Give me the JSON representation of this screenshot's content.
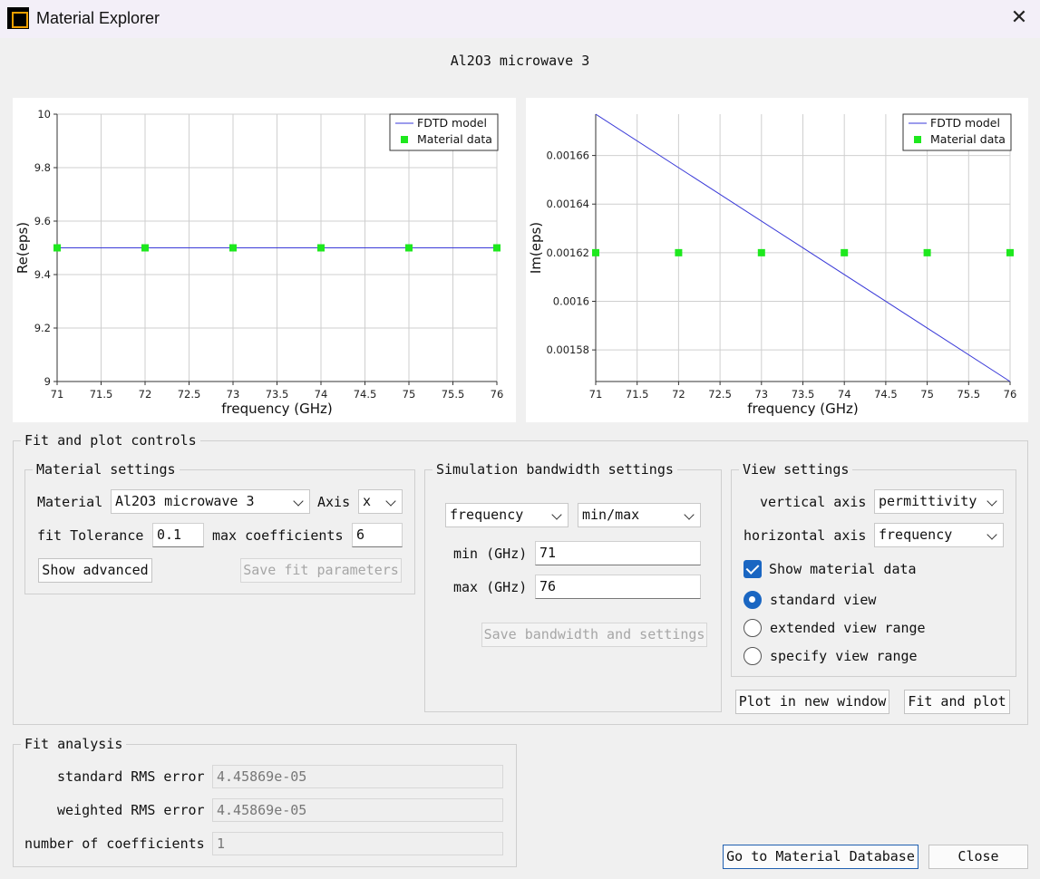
{
  "window": {
    "title": "Material Explorer",
    "close_glyph": "✕",
    "app_icon": "app-logo-icon"
  },
  "heading": "Al2O3 microwave 3",
  "chart_data": [
    {
      "type": "line",
      "xlabel": "frequency (GHz)",
      "ylabel": "Re(eps)",
      "xlim": [
        71,
        76
      ],
      "ylim": [
        9,
        10
      ],
      "xticks": [
        71,
        71.5,
        72,
        72.5,
        73,
        73.5,
        74,
        74.5,
        75,
        75.5,
        76
      ],
      "xtick_labels": [
        "71",
        "71.5",
        "72",
        "72.5",
        "73",
        "73.5",
        "74",
        "74.5",
        "75",
        "75.5",
        "76"
      ],
      "yticks": [
        9,
        9.2,
        9.4,
        9.6,
        9.8,
        10
      ],
      "ytick_labels": [
        "9",
        "9.2",
        "9.4",
        "9.6",
        "9.8",
        "10"
      ],
      "grid": true,
      "legend_position": "top-right",
      "series": [
        {
          "name": "FDTD model",
          "kind": "line",
          "color": "#3a3ad8",
          "x": [
            71,
            76
          ],
          "y": [
            9.5,
            9.5
          ]
        },
        {
          "name": "Material data",
          "kind": "marker",
          "color": "#1ee81e",
          "x": [
            71,
            72,
            73,
            74,
            75,
            76
          ],
          "y": [
            9.5,
            9.5,
            9.5,
            9.5,
            9.5,
            9.5
          ]
        }
      ]
    },
    {
      "type": "line",
      "xlabel": "frequency (GHz)",
      "ylabel": "Im(eps)",
      "xlim": [
        71,
        76
      ],
      "ylim": [
        0.001567,
        0.001677
      ],
      "xticks": [
        71,
        71.5,
        72,
        72.5,
        73,
        73.5,
        74,
        74.5,
        75,
        75.5,
        76
      ],
      "xtick_labels": [
        "71",
        "71.5",
        "72",
        "72.5",
        "73",
        "73.5",
        "74",
        "74.5",
        "75",
        "75.5",
        "76"
      ],
      "yticks": [
        0.00158,
        0.0016,
        0.00162,
        0.00164,
        0.00166
      ],
      "ytick_labels": [
        "0.00158",
        "0.0016",
        "0.00162",
        "0.00164",
        "0.00166"
      ],
      "grid": true,
      "legend_position": "top-right",
      "series": [
        {
          "name": "FDTD model",
          "kind": "line",
          "color": "#3a3ad8",
          "x": [
            71,
            76
          ],
          "y": [
            0.001677,
            0.001567
          ]
        },
        {
          "name": "Material data",
          "kind": "marker",
          "color": "#1ee81e",
          "x": [
            71,
            72,
            73,
            74,
            75,
            76
          ],
          "y": [
            0.00162,
            0.00162,
            0.00162,
            0.00162,
            0.00162,
            0.00162
          ]
        }
      ]
    }
  ],
  "fit_controls": {
    "title": "Fit and plot controls",
    "material_settings": {
      "title": "Material settings",
      "material_label": "Material",
      "material_value": "Al2O3 microwave 3",
      "axis_label": "Axis",
      "axis_value": "x",
      "tolerance_label": "fit Tolerance",
      "tolerance_value": "0.1",
      "max_coeff_label": "max coefficients",
      "max_coeff_value": "6",
      "show_advanced": "Show advanced",
      "save_fit": "Save fit parameters"
    },
    "bandwidth": {
      "title": "Simulation bandwidth settings",
      "mode_value": "frequency",
      "range_value": "min/max",
      "min_label": "min (GHz)",
      "min_value": "71",
      "max_label": "max (GHz)",
      "max_value": "76",
      "save_label": "Save bandwidth and settings"
    },
    "view": {
      "title": "View settings",
      "vertical_label": "vertical axis",
      "vertical_value": "permittivity",
      "horizontal_label": "horizontal axis",
      "horizontal_value": "frequency",
      "show_material_data": "Show material data",
      "show_material_data_checked": true,
      "radio_standard": "standard view",
      "radio_extended": "extended view range",
      "radio_specify": "specify view range",
      "selected_radio": "standard view"
    },
    "plot_new_window": "Plot in new window",
    "fit_and_plot": "Fit and plot"
  },
  "fit_analysis": {
    "title": "Fit analysis",
    "standard_label": "standard RMS error",
    "standard_value": "4.45869e-05",
    "weighted_label": "weighted RMS error",
    "weighted_value": "4.45869e-05",
    "ncoeff_label": "number of coefficients",
    "ncoeff_value": "1"
  },
  "footer": {
    "goto_db": "Go to Material Database",
    "close": "Close"
  }
}
